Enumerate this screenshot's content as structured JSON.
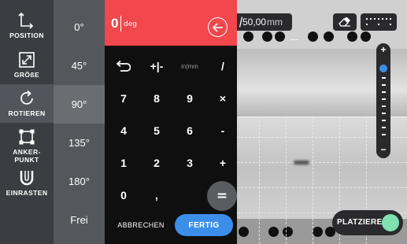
{
  "tools": [
    {
      "label": "POSITION",
      "icon": "move-icon"
    },
    {
      "label": "GRÖßE",
      "icon": "resize-icon"
    },
    {
      "label": "ROTIEREN",
      "icon": "rotate-icon",
      "active": true
    },
    {
      "label": "ANKER-\nPUNKT",
      "icon": "anchor-point-icon"
    },
    {
      "label": "EINRASTEN",
      "icon": "magnet-icon"
    }
  ],
  "angles": [
    "0°",
    "45°",
    "90°",
    "135°",
    "180°",
    "Frei"
  ],
  "keypad": {
    "display_value": "0",
    "display_unit": "deg",
    "row1": [
      "+|-",
      "in|mm",
      "/"
    ],
    "rows": [
      [
        "7",
        "8",
        "9",
        "×"
      ],
      [
        "4",
        "5",
        "6",
        "-"
      ],
      [
        "1",
        "2",
        "3",
        "+"
      ]
    ],
    "row5": [
      "0",
      ","
    ],
    "equals": "=",
    "cancel": "ABBRECHEN",
    "done": "FERTIG"
  },
  "camera": {
    "measure_value": "50,00",
    "measure_unit": "mm",
    "place_label": "PLATZIEREN",
    "zoom_plus": "+",
    "zoom_minus": "−"
  },
  "colors": {
    "accent": "#f2474c",
    "primary": "#3c8fe8",
    "toggle": "#7fe0b0"
  }
}
